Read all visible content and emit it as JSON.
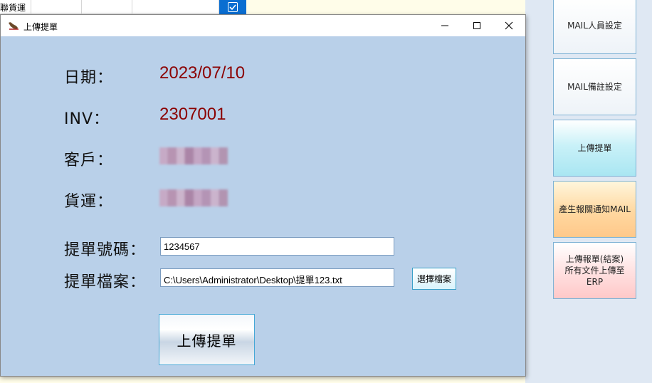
{
  "background_app": {
    "grid_cell_text": "聯貨運",
    "checkbox_checked": true,
    "side_buttons": [
      {
        "label": "MAIL人員設定",
        "style": "plain"
      },
      {
        "label": "MAIL備註設定",
        "style": "plain"
      },
      {
        "label": "上傳提單",
        "style": "cyan"
      },
      {
        "label": "產生報關通知MAIL",
        "style": "orange"
      },
      {
        "label": "上傳報單(結案)\n所有文件上傳至\nERP",
        "style": "pink"
      }
    ]
  },
  "dialog": {
    "title": "上傳提單",
    "date_label": "日期：",
    "date_value": "2023/07/10",
    "inv_label": "INV：",
    "inv_value": "2307001",
    "customer_label": "客戶：",
    "freight_label": "貨運：",
    "bill_no_label": "提單號碼：",
    "bill_no_value": "1234567",
    "bill_file_label": "提單檔案：",
    "bill_file_value": "C:\\Users\\Administrator\\Desktop\\提單123.txt",
    "choose_file_button": "選擇檔案",
    "upload_button": "上傳提單",
    "colors": {
      "value_text": "#8b0000",
      "dialog_bg": "#b9d0e9"
    }
  }
}
